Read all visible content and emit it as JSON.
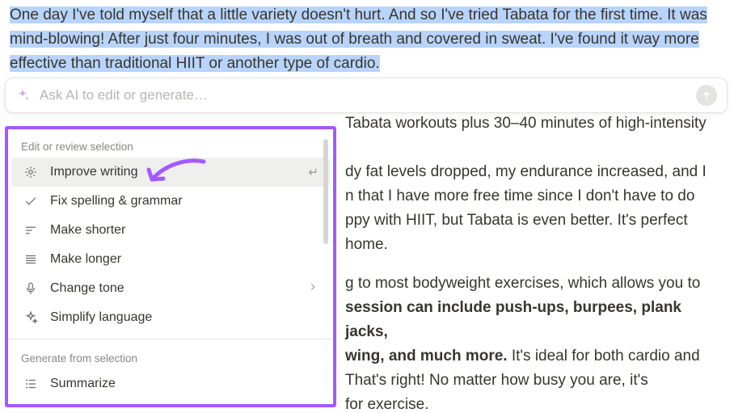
{
  "selection_text": "One day I've told myself that a little variety doesn't hurt. And so I've tried Tabata for the first time. It was mind-blowing! After just four minutes, I was out of breath and covered in sweat. I've found it way more effective than traditional HIIT or another type of cardio.",
  "ai_bar": {
    "placeholder": "Ask AI to edit or generate…"
  },
  "under_lines": {
    "l0": "Tabata workouts plus 30–40 minutes of high-intensity",
    "l1a": "dy fat levels dropped, my endurance increased, and I",
    "l1b": "n that I have more free time since I don't have to do",
    "l1c": "ppy with HIIT, but Tabata is even better. It's perfect",
    "l1d": "home.",
    "l2a": "g to most bodyweight exercises, which allows you to",
    "l2b_bold": "session can include push-ups, burpees, plank jacks,",
    "l2c_bold": "wing, and much more.",
    "l2c_rest": " It's ideal for both cardio and",
    "l2d": "That's right! No matter how busy you are, it's",
    "l2e": "for exercise."
  },
  "panel": {
    "edit_label": "Edit or review selection",
    "generate_label": "Generate from selection",
    "items": {
      "improve": "Improve writing",
      "fix": "Fix spelling & grammar",
      "shorter": "Make shorter",
      "longer": "Make longer",
      "tone": "Change tone",
      "simplify": "Simplify language",
      "summarize": "Summarize"
    },
    "enter_hint": "↵"
  }
}
